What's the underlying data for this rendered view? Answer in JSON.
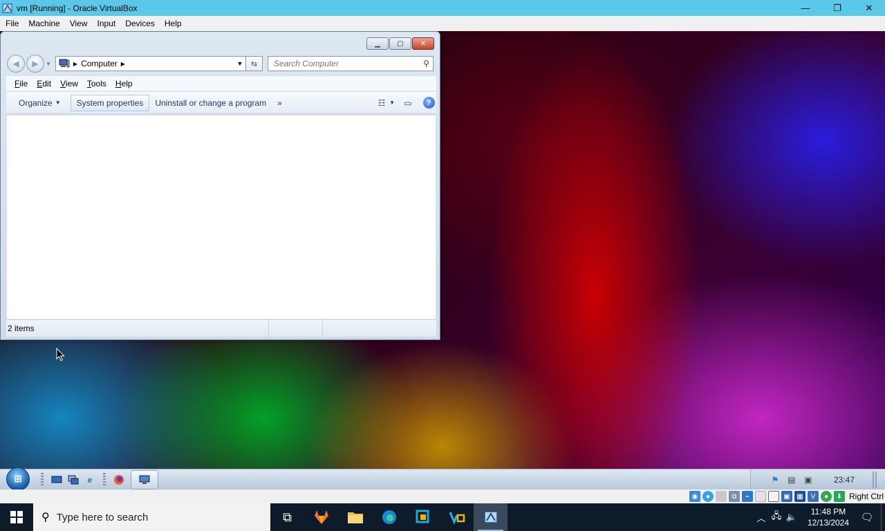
{
  "host_window": {
    "title": "vm [Running] - Oracle VirtualBox",
    "menu": [
      "File",
      "Machine",
      "View",
      "Input",
      "Devices",
      "Help"
    ],
    "controls": {
      "minimize": "—",
      "restore": "❐",
      "close": "✕"
    }
  },
  "explorer": {
    "address": {
      "location": "Computer"
    },
    "search": {
      "placeholder": "Search Computer"
    },
    "menu": [
      "File",
      "Edit",
      "View",
      "Tools",
      "Help"
    ],
    "commands": {
      "organize": "Organize",
      "system_properties": "System properties",
      "uninstall": "Uninstall or change a program",
      "more": "»"
    },
    "status": {
      "items": "2 items"
    }
  },
  "guest_taskbar": {
    "clock": "23:47",
    "quick_launch": [
      "show-desktop-icon",
      "switch-windows-icon",
      "internet-explorer-icon"
    ],
    "pinned": [
      "firefox-icon"
    ],
    "running": [
      "explorer-computer-icon"
    ]
  },
  "vbox_status": {
    "host_key": "Right Ctrl",
    "indicators": [
      "hard-disk-icon",
      "optical-drive-icon",
      "audio-icon",
      "network-icon",
      "usb-icon",
      "shared-folders-icon",
      "display-icon",
      "recording-icon",
      "capture-icon",
      "cpu-icon",
      "mouse-integration-icon",
      "keyboard-icon"
    ]
  },
  "host_taskbar": {
    "search_placeholder": "Type here to search",
    "apps": [
      "task-view-icon",
      "gitlab-icon",
      "file-explorer-icon",
      "edge-icon",
      "app-cube-icon",
      "vmware-icon",
      "virtualbox-icon"
    ],
    "time": "11:48 PM",
    "date": "12/13/2024"
  },
  "colors": {
    "vbox_title": "#5bc8ea",
    "host_taskbar": "#0d1b2a",
    "accent": "#1d5bc7"
  }
}
